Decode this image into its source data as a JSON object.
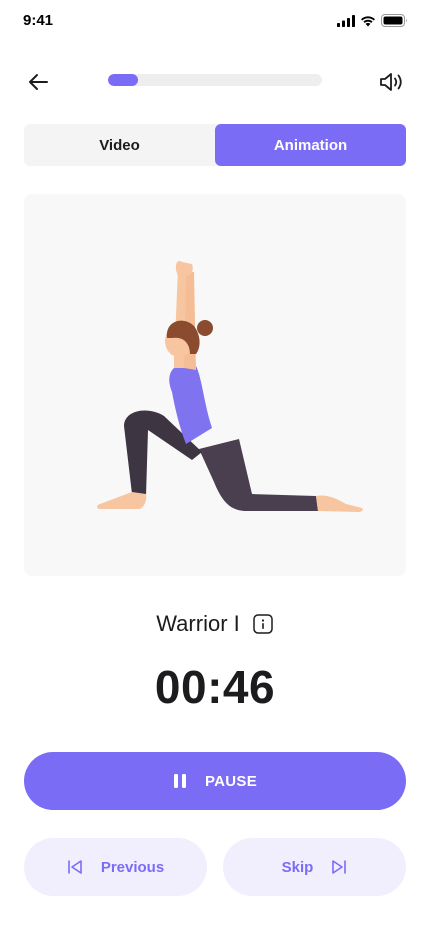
{
  "status_bar": {
    "time": "9:41"
  },
  "header": {
    "progress_fraction": 0.14
  },
  "tabs": [
    {
      "label": "Video",
      "active": false
    },
    {
      "label": "Animation",
      "active": true
    }
  ],
  "exercise": {
    "name": "Warrior I",
    "timer": "00:46"
  },
  "controls": {
    "pause_label": "PAUSE",
    "previous_label": "Previous",
    "skip_label": "Skip"
  },
  "colors": {
    "accent": "#7b6cf6",
    "accent_light": "#f1effe",
    "panel_bg": "#f8f8f8",
    "track": "#eeeeee"
  },
  "icons": [
    "back-arrow-icon",
    "speaker-icon",
    "info-icon",
    "pause-icon",
    "skip-back-icon",
    "skip-forward-icon",
    "signal-icon",
    "wifi-icon",
    "battery-icon"
  ]
}
